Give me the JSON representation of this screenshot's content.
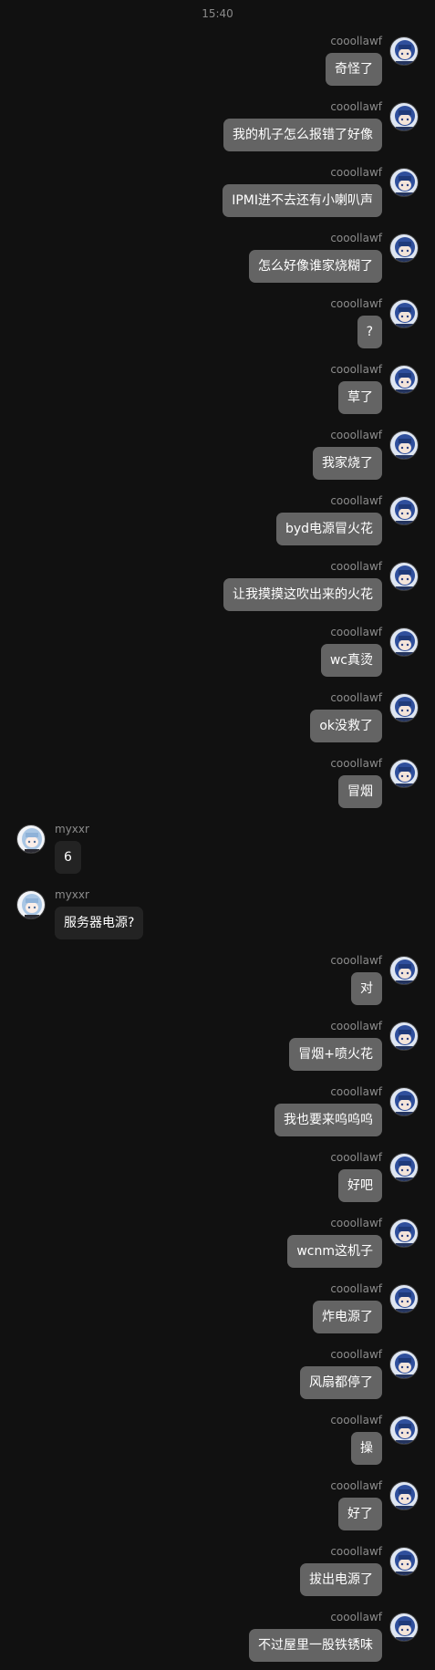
{
  "timestamp": "15:40",
  "messages": [
    {
      "sender": "cooollawf",
      "side": "mine",
      "text": "奇怪了"
    },
    {
      "sender": "cooollawf",
      "side": "mine",
      "text": "我的机子怎么报错了好像"
    },
    {
      "sender": "cooollawf",
      "side": "mine",
      "text": "IPMI进不去还有小喇叭声"
    },
    {
      "sender": "cooollawf",
      "side": "mine",
      "text": "怎么好像谁家烧糊了"
    },
    {
      "sender": "cooollawf",
      "side": "mine",
      "text": "?"
    },
    {
      "sender": "cooollawf",
      "side": "mine",
      "text": "草了"
    },
    {
      "sender": "cooollawf",
      "side": "mine",
      "text": "我家烧了"
    },
    {
      "sender": "cooollawf",
      "side": "mine",
      "text": "byd电源冒火花"
    },
    {
      "sender": "cooollawf",
      "side": "mine",
      "text": "让我摸摸这吹出来的火花"
    },
    {
      "sender": "cooollawf",
      "side": "mine",
      "text": "wc真烫"
    },
    {
      "sender": "cooollawf",
      "side": "mine",
      "text": "ok没救了"
    },
    {
      "sender": "cooollawf",
      "side": "mine",
      "text": "冒烟"
    },
    {
      "sender": "myxxr",
      "side": "theirs",
      "text": "6"
    },
    {
      "sender": "myxxr",
      "side": "theirs",
      "text": "服务器电源?"
    },
    {
      "sender": "cooollawf",
      "side": "mine",
      "text": "对"
    },
    {
      "sender": "cooollawf",
      "side": "mine",
      "text": "冒烟+喷火花"
    },
    {
      "sender": "cooollawf",
      "side": "mine",
      "text": "我也要来呜呜呜"
    },
    {
      "sender": "cooollawf",
      "side": "mine",
      "text": "好吧"
    },
    {
      "sender": "cooollawf",
      "side": "mine",
      "text": "wcnm这机子"
    },
    {
      "sender": "cooollawf",
      "side": "mine",
      "text": "炸电源了"
    },
    {
      "sender": "cooollawf",
      "side": "mine",
      "text": "风扇都停了"
    },
    {
      "sender": "cooollawf",
      "side": "mine",
      "text": "操"
    },
    {
      "sender": "cooollawf",
      "side": "mine",
      "text": "好了"
    },
    {
      "sender": "cooollawf",
      "side": "mine",
      "text": "拔出电源了"
    },
    {
      "sender": "cooollawf",
      "side": "mine",
      "text": "不过屋里一股铁锈味"
    }
  ]
}
